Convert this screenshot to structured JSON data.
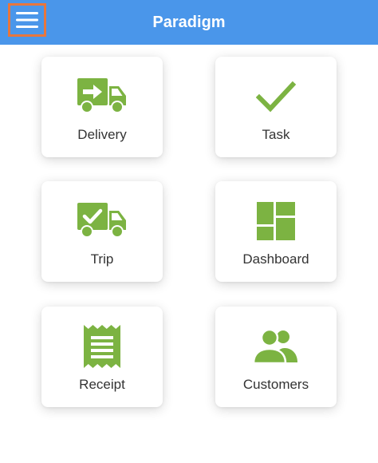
{
  "header": {
    "title": "Paradigm",
    "menu_icon": "hamburger-menu-icon",
    "background_color": "#4a96ea",
    "highlight_color": "#e8763d"
  },
  "accent_color": "#7cb342",
  "tiles": [
    {
      "label": "Delivery",
      "icon": "delivery-truck-arrow-icon"
    },
    {
      "label": "Task",
      "icon": "checkmark-icon"
    },
    {
      "label": "Trip",
      "icon": "truck-check-icon"
    },
    {
      "label": "Dashboard",
      "icon": "dashboard-grid-icon"
    },
    {
      "label": "Receipt",
      "icon": "receipt-icon"
    },
    {
      "label": "Customers",
      "icon": "people-group-icon"
    }
  ]
}
